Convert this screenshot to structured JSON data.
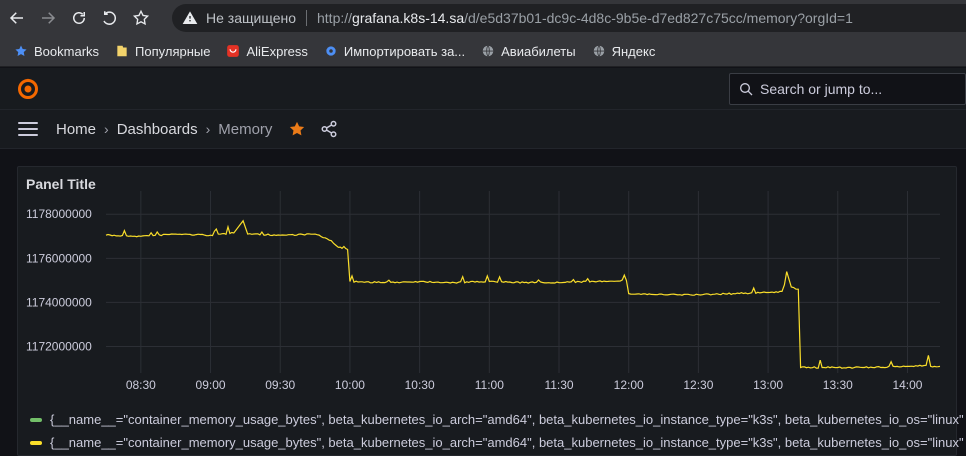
{
  "browser": {
    "insecure_label": "Не защищено",
    "url_prefix": "http://",
    "url_host": "grafana.k8s-14.sa",
    "url_path": "/d/e5d37b01-dc9c-4d8c-9b5e-d7ed827c75cc/memory?orgId=1",
    "bookmarks": [
      {
        "label": "Bookmarks",
        "icon": "star-icon",
        "color": "#4d8ff5"
      },
      {
        "label": "Популярные",
        "icon": "folder-icon",
        "color": "#f3d36b"
      },
      {
        "label": "AliExpress",
        "icon": "aliexpress-icon",
        "color": "#e43225"
      },
      {
        "label": "Импортировать за...",
        "icon": "gear-icon",
        "color": "#4d8ff5"
      },
      {
        "label": "Авиабилеты",
        "icon": "globe-icon",
        "color": "#9aa0a6"
      },
      {
        "label": "Яндекс",
        "icon": "globe-icon",
        "color": "#9aa0a6"
      }
    ]
  },
  "grafana": {
    "search_placeholder": "Search or jump to...",
    "breadcrumbs": [
      "Home",
      "Dashboards",
      "Memory"
    ],
    "accent_color": "#f46800",
    "star_color": "#eb7b18"
  },
  "panel": {
    "title": "Panel Title",
    "legend": [
      {
        "label": "{__name__=\"container_memory_usage_bytes\", beta_kubernetes_io_arch=\"amd64\", beta_kubernetes_io_instance_type=\"k3s\", beta_kubernetes_io_os=\"linux\"",
        "color": "#73bf69"
      },
      {
        "label": "{__name__=\"container_memory_usage_bytes\", beta_kubernetes_io_arch=\"amd64\", beta_kubernetes_io_instance_type=\"k3s\", beta_kubernetes_io_os=\"linux\"",
        "color": "#fade2a"
      }
    ]
  },
  "chart_data": {
    "type": "line",
    "x_ticks": [
      "08:30",
      "09:00",
      "09:30",
      "10:00",
      "10:30",
      "11:00",
      "11:30",
      "12:00",
      "12:30",
      "13:00",
      "13:30",
      "14:00"
    ],
    "y_ticks": [
      1172000000,
      1174000000,
      1176000000,
      1178000000
    ],
    "xlim": [
      "08:15",
      "14:14"
    ],
    "ylim": [
      1170800000,
      1178600000
    ],
    "grid": true,
    "legend_position": "bottom",
    "series": [
      {
        "color": "#fade2a",
        "points": [
          [
            "08:15",
            1177050000
          ],
          [
            "08:30",
            1177000000
          ],
          [
            "08:45",
            1177100000
          ],
          [
            "09:00",
            1177050000
          ],
          [
            "09:10",
            1177150000
          ],
          [
            "09:14",
            1177700000
          ],
          [
            "09:16",
            1177100000
          ],
          [
            "09:30",
            1177050000
          ],
          [
            "09:45",
            1177100000
          ],
          [
            "09:52",
            1176800000
          ],
          [
            "09:55",
            1176500000
          ],
          [
            "09:59",
            1176400000
          ],
          [
            "10:00",
            1174950000
          ],
          [
            "10:15",
            1174900000
          ],
          [
            "10:30",
            1174950000
          ],
          [
            "10:45",
            1174900000
          ],
          [
            "11:00",
            1174950000
          ],
          [
            "11:15",
            1174900000
          ],
          [
            "11:30",
            1174900000
          ],
          [
            "11:45",
            1174950000
          ],
          [
            "11:59",
            1175000000
          ],
          [
            "12:00",
            1174400000
          ],
          [
            "12:15",
            1174350000
          ],
          [
            "12:30",
            1174350000
          ],
          [
            "12:45",
            1174400000
          ],
          [
            "13:00",
            1174450000
          ],
          [
            "13:06",
            1174500000
          ],
          [
            "13:07",
            1174800000
          ],
          [
            "13:08",
            1175400000
          ],
          [
            "13:10",
            1174700000
          ],
          [
            "13:12",
            1174600000
          ],
          [
            "13:13",
            1174600000
          ],
          [
            "13:14",
            1171050000
          ],
          [
            "13:30",
            1171050000
          ],
          [
            "13:45",
            1171050000
          ],
          [
            "14:00",
            1171100000
          ],
          [
            "14:08",
            1171150000
          ],
          [
            "14:09",
            1171600000
          ],
          [
            "14:10",
            1171100000
          ],
          [
            "14:14",
            1171100000
          ]
        ]
      }
    ]
  }
}
